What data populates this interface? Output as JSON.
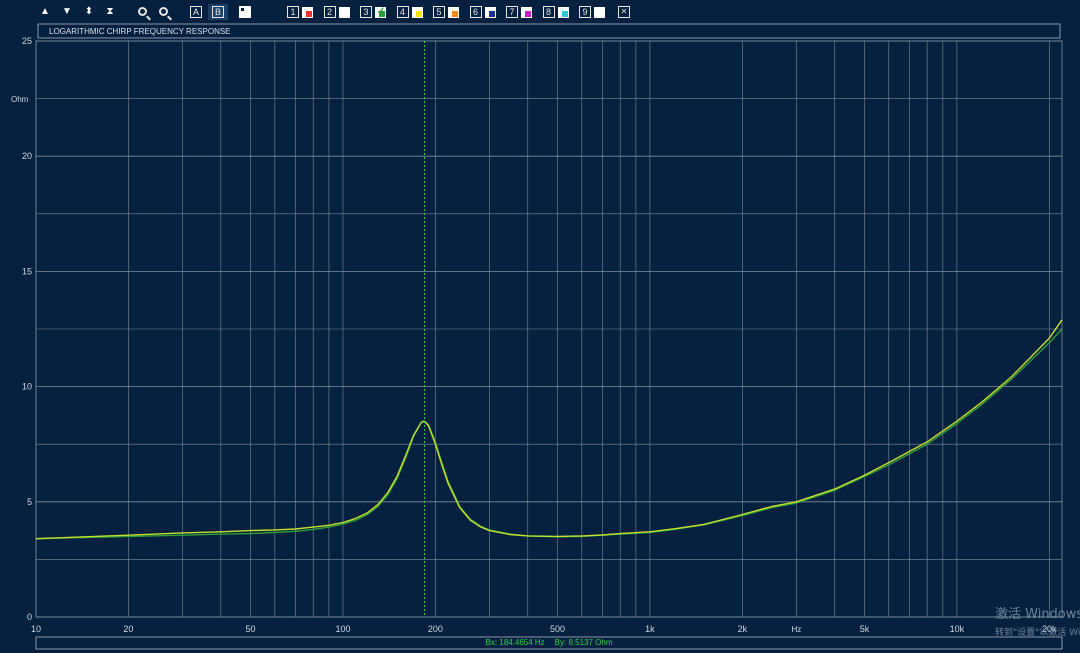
{
  "toolbar": {
    "arrows": [
      {
        "name": "scroll-up-icon",
        "glyph": "▲"
      },
      {
        "name": "scroll-down-icon",
        "glyph": "▼"
      },
      {
        "name": "expand-vertical-icon",
        "glyph": "⬍"
      },
      {
        "name": "collapse-vertical-icon",
        "glyph": "⧗"
      }
    ],
    "zoom": [
      "zoom-in-icon",
      "zoom-out-icon"
    ],
    "cursor_a": "A",
    "cursor_b": "B",
    "channels": [
      {
        "label": "1",
        "color": "#e8322c",
        "checked": false
      },
      {
        "label": "2",
        "color": "#ffffff",
        "checked": false
      },
      {
        "label": "3",
        "color": "#2a9d3a",
        "checked": true
      },
      {
        "label": "4",
        "color": "#f2e20a",
        "checked": false
      },
      {
        "label": "5",
        "color": "#f08a1c",
        "checked": false
      },
      {
        "label": "6",
        "color": "#1a2f9e",
        "checked": false
      },
      {
        "label": "7",
        "color": "#c81ec8",
        "checked": false
      },
      {
        "label": "8",
        "color": "#2fc4d6",
        "checked": false
      },
      {
        "label": "9",
        "color": "#ffffff",
        "checked": false
      }
    ],
    "close": "✕"
  },
  "chart_data": {
    "type": "line",
    "title": "LOGARITHMIC CHIRP FREQUENCY RESPONSE",
    "xlabel": "Hz",
    "ylabel": "Ohm",
    "xscale": "log",
    "xlim": [
      10,
      22000
    ],
    "ylim": [
      0,
      25
    ],
    "grid": true,
    "background": "#06213f",
    "grid_color": "#7c8c9e",
    "x_ticks": [
      {
        "value": 10,
        "label": "10"
      },
      {
        "value": 20,
        "label": "20"
      },
      {
        "value": 50,
        "label": "50"
      },
      {
        "value": 100,
        "label": "100"
      },
      {
        "value": 200,
        "label": "200"
      },
      {
        "value": 500,
        "label": "500"
      },
      {
        "value": 1000,
        "label": "1k"
      },
      {
        "value": 2000,
        "label": "2k"
      },
      {
        "value": 5000,
        "label": "5k"
      },
      {
        "value": 10000,
        "label": "10k"
      },
      {
        "value": 20000,
        "label": "20k"
      }
    ],
    "y_ticks": [
      0,
      5,
      10,
      15,
      20,
      25
    ],
    "y_minor": [
      2.5,
      7.5,
      12.5,
      17.5,
      22.5
    ],
    "cursor": {
      "x": 184.4654,
      "color": "#33d14a"
    },
    "readout": {
      "bx": "Bx: 184.4654 Hz",
      "by": "By: 8.5137 Ohm"
    },
    "series": [
      {
        "color": "#2e9e3c",
        "x": [
          10,
          20,
          30,
          40,
          50,
          60,
          70,
          80,
          90,
          100,
          110,
          120,
          130,
          140,
          150,
          160,
          170,
          180,
          184,
          190,
          200,
          210,
          220,
          240,
          260,
          280,
          300,
          350,
          400,
          500,
          600,
          700,
          800,
          1000,
          1200,
          1500,
          2000,
          2500,
          3000,
          4000,
          5000,
          6000,
          8000,
          10000,
          12000,
          15000,
          20000,
          22000
        ],
        "y": [
          3.4,
          3.5,
          3.55,
          3.6,
          3.62,
          3.67,
          3.72,
          3.8,
          3.9,
          4.03,
          4.2,
          4.45,
          4.8,
          5.3,
          6.0,
          6.9,
          7.85,
          8.45,
          8.51,
          8.35,
          7.6,
          6.7,
          5.9,
          4.8,
          4.25,
          3.95,
          3.78,
          3.6,
          3.52,
          3.48,
          3.5,
          3.55,
          3.6,
          3.67,
          3.8,
          4.0,
          4.4,
          4.75,
          4.95,
          5.5,
          6.1,
          6.6,
          7.5,
          8.4,
          9.2,
          10.3,
          11.9,
          12.5
        ]
      },
      {
        "color": "#c5e02a",
        "x": [
          10,
          20,
          30,
          40,
          50,
          60,
          70,
          80,
          90,
          100,
          110,
          120,
          130,
          140,
          150,
          160,
          170,
          180,
          184,
          190,
          200,
          210,
          220,
          240,
          260,
          280,
          300,
          350,
          400,
          500,
          600,
          700,
          800,
          1000,
          1200,
          1500,
          2000,
          2500,
          3000,
          4000,
          5000,
          6000,
          8000,
          10000,
          12000,
          15000,
          20000,
          22000
        ],
        "y": [
          3.4,
          3.55,
          3.65,
          3.7,
          3.75,
          3.78,
          3.82,
          3.9,
          3.98,
          4.1,
          4.28,
          4.52,
          4.88,
          5.4,
          6.1,
          7.0,
          7.9,
          8.45,
          8.5,
          8.3,
          7.5,
          6.6,
          5.8,
          4.75,
          4.2,
          3.92,
          3.75,
          3.58,
          3.52,
          3.5,
          3.52,
          3.56,
          3.62,
          3.7,
          3.83,
          4.02,
          4.45,
          4.8,
          5.0,
          5.55,
          6.15,
          6.7,
          7.6,
          8.5,
          9.3,
          10.4,
          12.1,
          12.9
        ]
      }
    ]
  },
  "watermark": {
    "line1": "激活 Windows",
    "line2": "转到\"设置\"以激活 Windows"
  }
}
